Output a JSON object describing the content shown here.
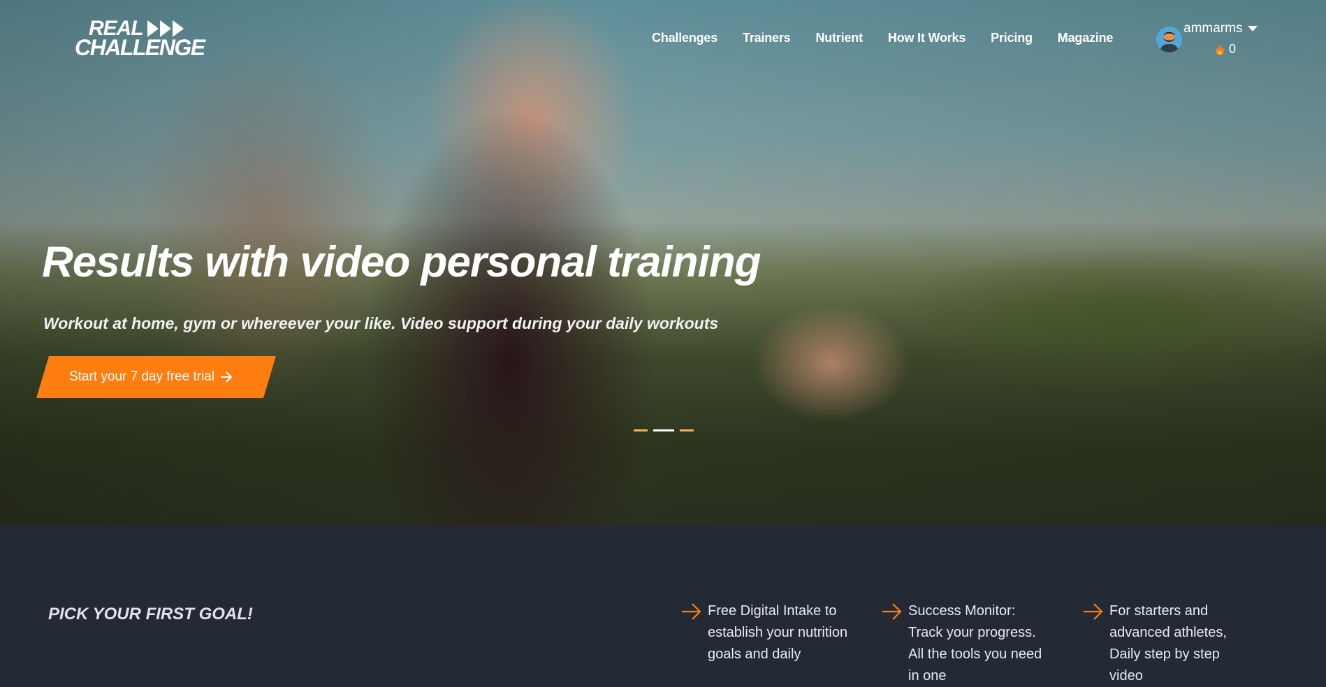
{
  "brand": {
    "line1": "REAL",
    "line2": "CHALLENGE"
  },
  "nav": {
    "items": [
      {
        "label": "Challenges"
      },
      {
        "label": "Trainers"
      },
      {
        "label": "Nutrient"
      },
      {
        "label": "How It Works"
      },
      {
        "label": "Pricing"
      },
      {
        "label": "Magazine"
      }
    ]
  },
  "user": {
    "name": "ammarms",
    "points": "0"
  },
  "hero": {
    "title": "Results with video personal training",
    "subtitle": "Workout at home, gym or whereever your like. Video support during your daily workouts",
    "cta_label": "Start your 7 day free trial",
    "slides": 3,
    "active_slide": 2
  },
  "goal_heading": "PICK YOUR FIRST GOAL!",
  "features": [
    {
      "text": "Free Digital Intake to establish your nutrition goals and daily"
    },
    {
      "text": "Success Monitor: Track your progress. All the tools you need in one"
    },
    {
      "text": "For starters and advanced athletes, Daily step by step video"
    }
  ],
  "colors": {
    "accent": "#ff7e0f",
    "dark_bg": "#232a36",
    "indicator": "#f7b34a"
  }
}
